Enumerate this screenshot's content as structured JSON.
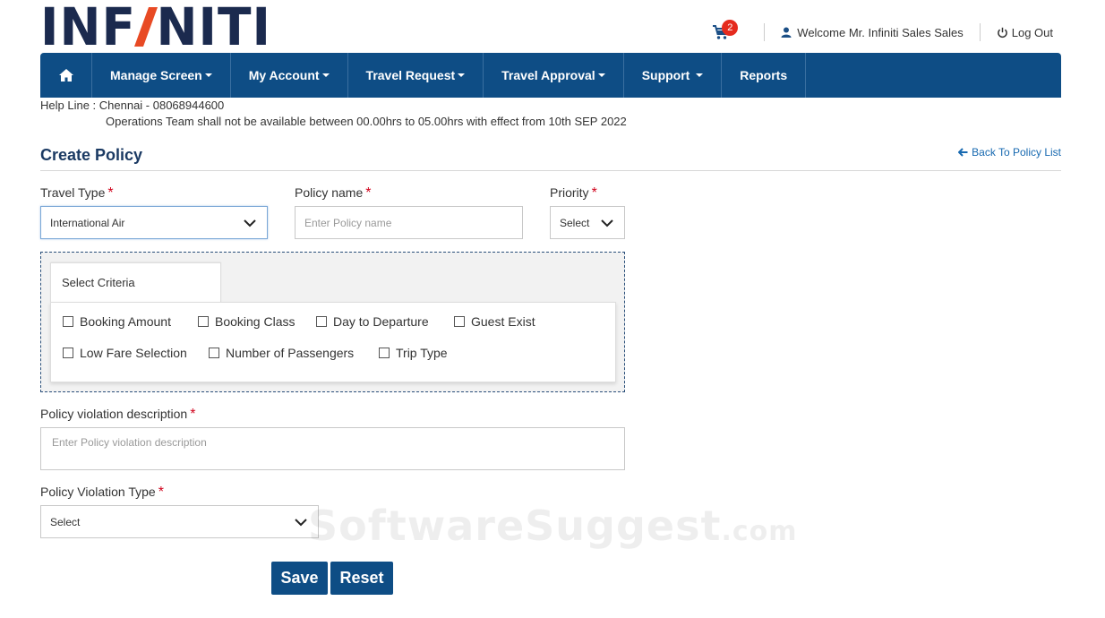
{
  "brand": {
    "logo_text_left": "INF",
    "logo_text_right": "NITI",
    "accent_color": "#e84a24",
    "primary_color": "#0e4d85"
  },
  "topbar": {
    "cart_count": "2",
    "welcome_text": "Welcome Mr. Infiniti Sales Sales",
    "logout_label": "Log Out"
  },
  "nav": {
    "items": [
      {
        "label": "Manage Screen",
        "has_dropdown": true
      },
      {
        "label": "My Account",
        "has_dropdown": true
      },
      {
        "label": "Travel Request",
        "has_dropdown": true
      },
      {
        "label": "Travel Approval",
        "has_dropdown": true
      },
      {
        "label": "Support",
        "has_dropdown": true
      },
      {
        "label": "Reports",
        "has_dropdown": false
      }
    ]
  },
  "info": {
    "helpline": "Help Line : Chennai - 08068944600",
    "notice": "Operations Team shall not be available between 00.00hrs to 05.00hrs with effect from 10th SEP 2022"
  },
  "page": {
    "title": "Create Policy",
    "back_link": "Back To Policy List"
  },
  "form": {
    "travel_type": {
      "label": "Travel Type",
      "value": "International Air"
    },
    "policy_name": {
      "label": "Policy name",
      "placeholder": "Enter Policy name"
    },
    "priority": {
      "label": "Priority",
      "value": "Select"
    },
    "criteria": {
      "tab_label": "Select Criteria",
      "options": [
        "Booking Amount",
        "Booking Class",
        "Day to Departure",
        "Guest Exist",
        "Low Fare Selection",
        "Number of Passengers",
        "Trip Type"
      ]
    },
    "violation_description": {
      "label": "Policy violation description",
      "placeholder": "Enter Policy violation description"
    },
    "violation_type": {
      "label": "Policy Violation Type",
      "value": "Select"
    },
    "save_label": "Save",
    "reset_label": "Reset"
  },
  "watermark": {
    "main": "SoftwareSuggest",
    "suffix": ".com"
  }
}
